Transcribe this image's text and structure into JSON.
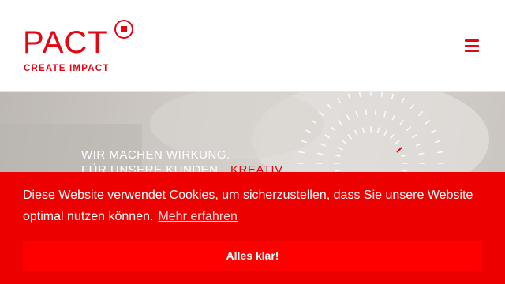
{
  "colors": {
    "brand_red": "#e30613",
    "banner_red": "#ec0000",
    "button_red": "#ff0000",
    "hero_gray": "#cfcac5"
  },
  "header": {
    "logo_word": "PACT",
    "logo_tagline": "CREATE IMPACT",
    "logo_mark_icon": "square-in-circle-icon",
    "menu_icon": "hamburger-icon"
  },
  "hero": {
    "line1": "WIR MACHEN WIRKUNG.",
    "line2": "FÜR UNSERE KUNDEN.",
    "accent": "KREATIV"
  },
  "cookie_banner": {
    "message": "Diese Website verwendet Cookies, um sicherzustellen, dass Sie unsere Website optimal nutzen können.",
    "link_label": "Mehr erfahren",
    "dismiss_label": "Alles klar!"
  }
}
